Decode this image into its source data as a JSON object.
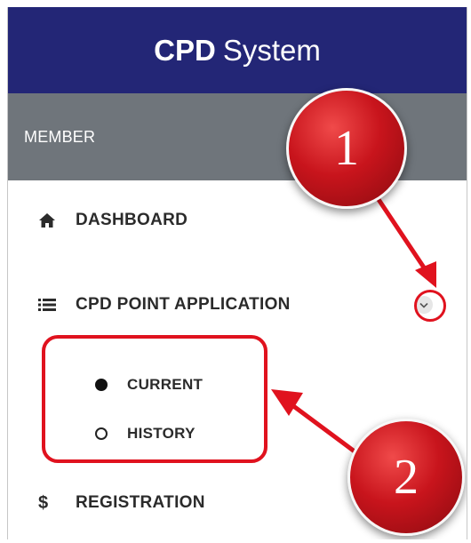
{
  "header": {
    "brand_bold": "CPD",
    "brand_rest": "System"
  },
  "section": {
    "label": "MEMBER"
  },
  "menu": {
    "dashboard": {
      "label": "DASHBOARD",
      "icon": "home-icon"
    },
    "cpd_point_application": {
      "label": "CPD POINT APPLICATION",
      "icon": "list-icon",
      "expand_icon": "chevron-down-icon"
    },
    "submenu": [
      {
        "label": "CURRENT",
        "state": "selected"
      },
      {
        "label": "HISTORY",
        "state": "unselected"
      }
    ],
    "registration": {
      "label": "REGISTRATION",
      "icon_glyph": "$"
    }
  },
  "annotations": {
    "step1": "1",
    "step2": "2",
    "color": "#e0121e"
  },
  "colors": {
    "header_bg": "#232676",
    "section_bg": "#6f757b",
    "text": "#2b2b2b"
  }
}
